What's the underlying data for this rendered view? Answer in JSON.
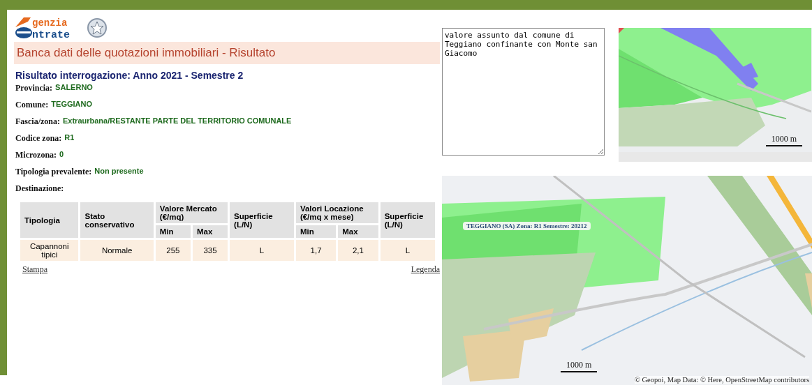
{
  "logo": {
    "first": "genzia",
    "second": "ntrate"
  },
  "banner": {
    "title": "Banca dati delle quotazioni immobiliari - Risultato"
  },
  "heading": "Risultato interrogazione: Anno 2021 - Semestre 2",
  "fields": [
    {
      "label": "Provincia:",
      "value": "SALERNO"
    },
    {
      "label": "Comune:",
      "value": "TEGGIANO"
    },
    {
      "label": "Fascia/zona:",
      "value": "Extraurbana/RESTANTE PARTE DEL TERRITORIO COMUNALE"
    },
    {
      "label": "Codice zona:",
      "value": "R1"
    },
    {
      "label": "Microzona:",
      "value": "0"
    },
    {
      "label": "Tipologia prevalente:",
      "value": "Non presente"
    },
    {
      "label": "Destinazione:"
    }
  ],
  "table": {
    "columns": [
      {
        "label": "Tipologia"
      },
      {
        "label": "Stato conservativo"
      },
      {
        "label": "Valore Mercato (€/mq)",
        "colspan": 2,
        "children": [
          {
            "label": "Min"
          },
          {
            "label": "Max"
          }
        ]
      },
      {
        "label": "Superficie (L/N)"
      },
      {
        "label": "Valori Locazione (€/mq x mese)",
        "colspan": 2,
        "children": [
          {
            "label": "Min"
          },
          {
            "label": "Max"
          }
        ]
      },
      {
        "label": "Superficie (L/N)"
      }
    ],
    "rows": [
      [
        "Capannoni tipici",
        "Normale",
        "255",
        "335",
        "L",
        "1,7",
        "2,1",
        "L"
      ]
    ]
  },
  "links": {
    "print": "Stampa",
    "legend": "Legenda"
  },
  "note": {
    "value": "valore assunto dal comune di Teggiano confinante con Monte san Giacomo"
  },
  "small_map": {
    "scale": "1000 m"
  },
  "big_map": {
    "zone_label": "TEGGIANO (SA) Zona: R1 Semestre: 20212",
    "scale": "1000 m",
    "attribution": "© Geopoi, Map Data: © Here, OpenStreetMap contributors"
  }
}
